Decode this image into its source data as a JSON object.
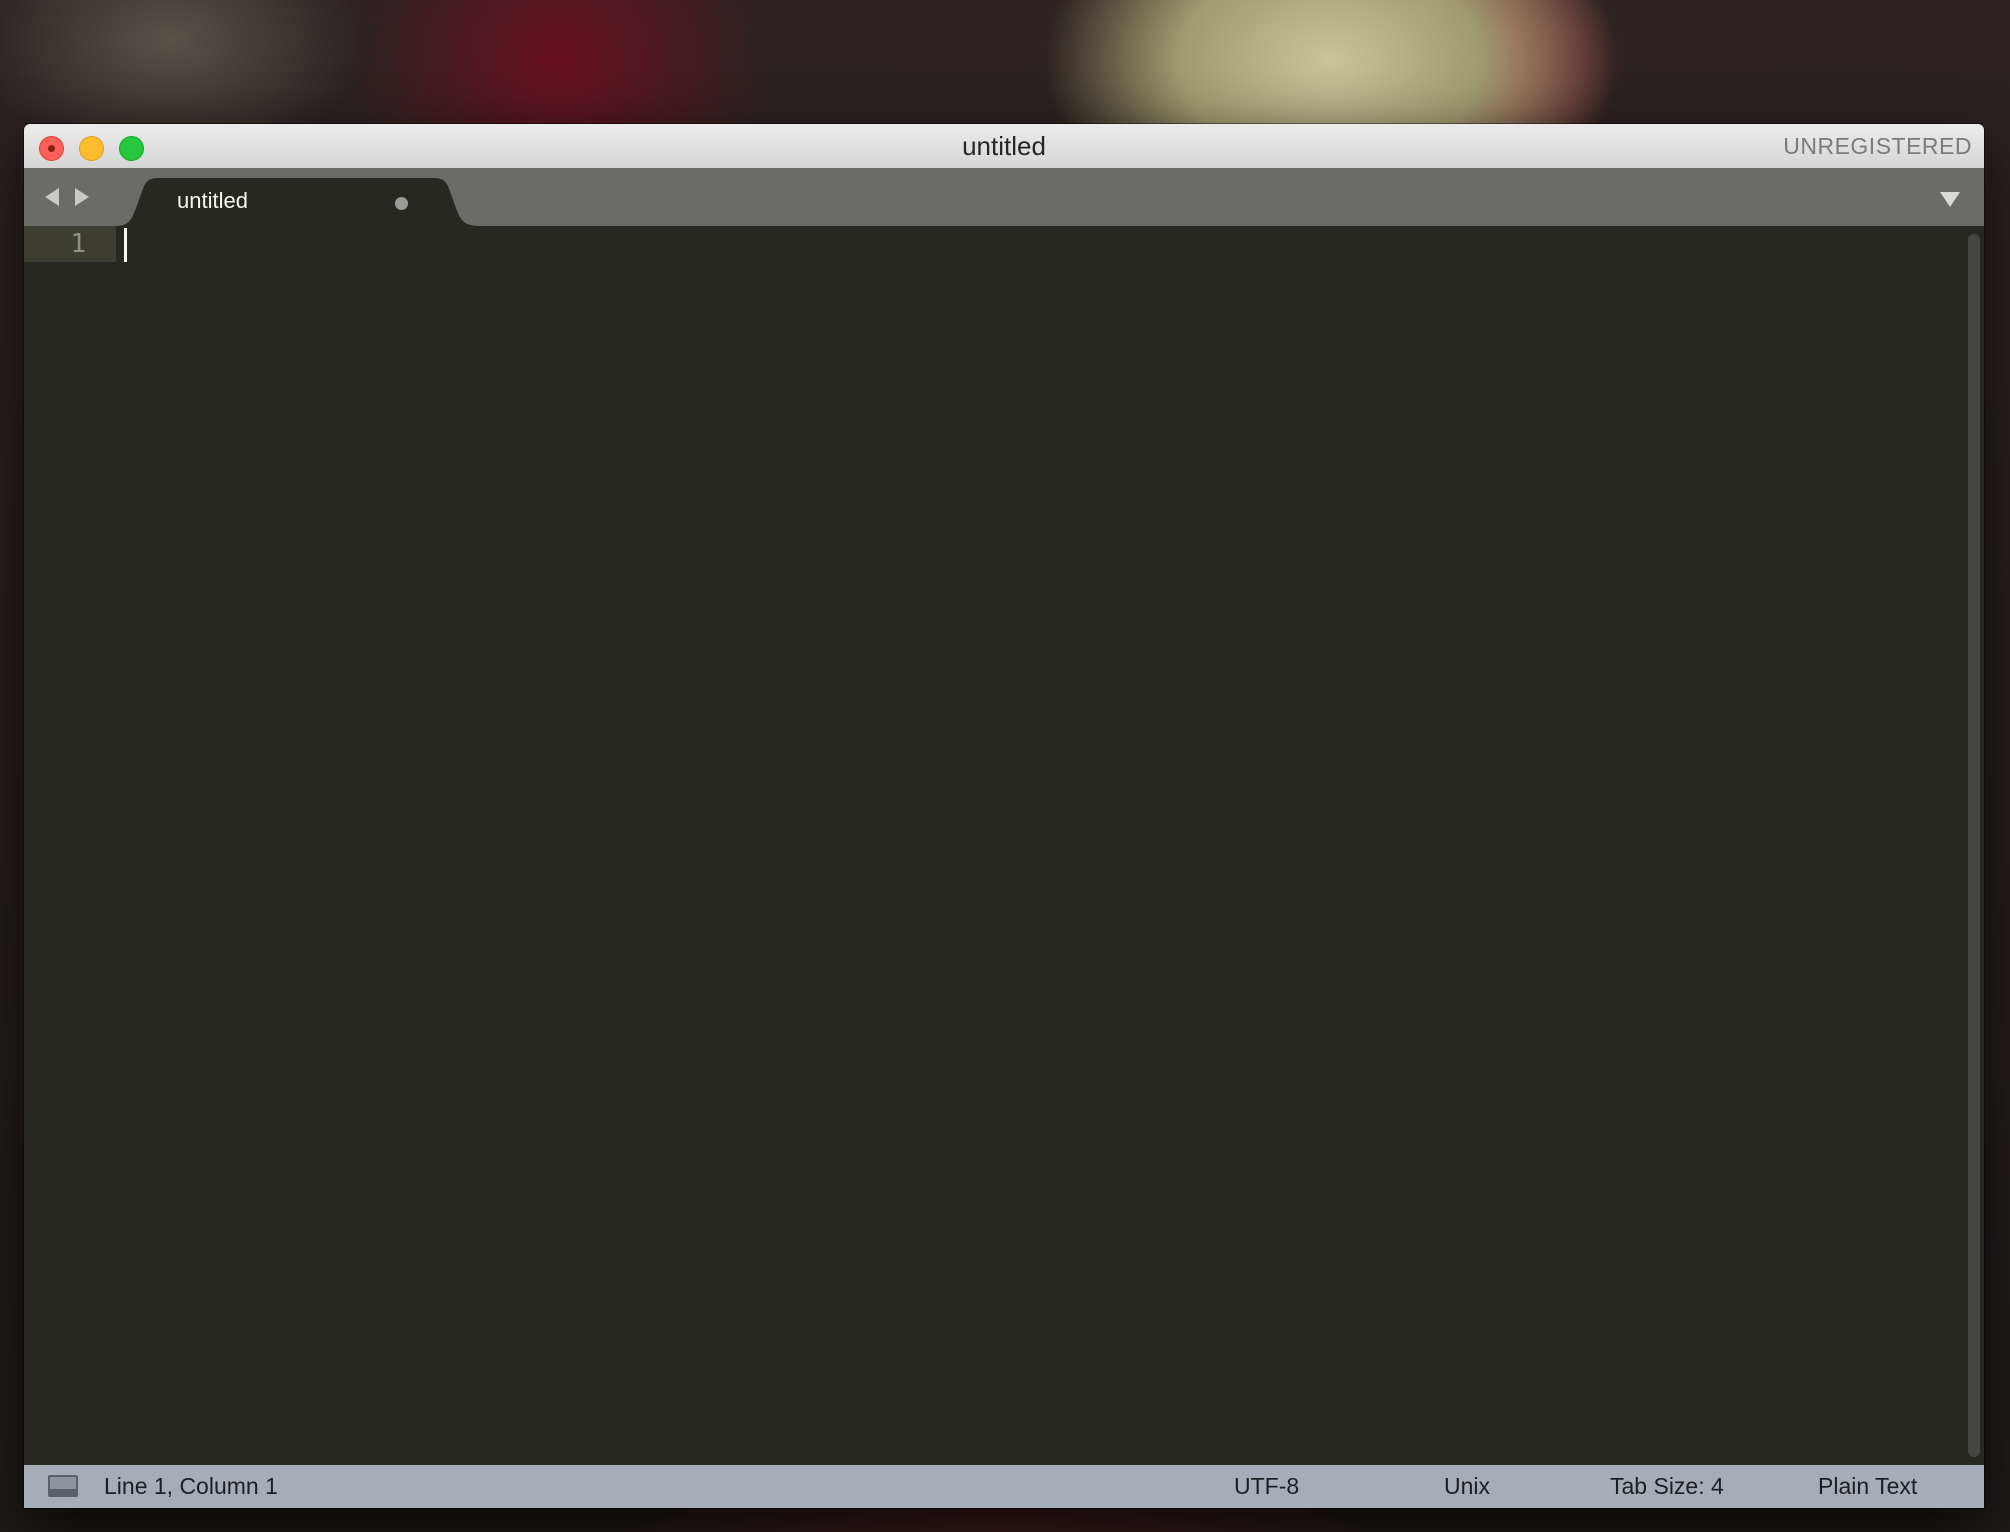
{
  "window": {
    "title": "untitled",
    "license_status": "UNREGISTERED"
  },
  "tabs": [
    {
      "label": "untitled",
      "modified": true,
      "active": true
    }
  ],
  "editor": {
    "line_numbers": [
      "1"
    ],
    "content": ""
  },
  "statusbar": {
    "cursor_position": "Line 1, Column 1",
    "encoding": "UTF-8",
    "line_endings": "Unix",
    "tab_size": "Tab Size: 4",
    "syntax": "Plain Text"
  },
  "colors": {
    "editor_bg": "#272822",
    "tabbar_bg": "#6b6c67",
    "statusbar_bg": "#a6adb6",
    "close": "#fc5f57",
    "minimize": "#fdbc2e",
    "zoom": "#27c840"
  }
}
